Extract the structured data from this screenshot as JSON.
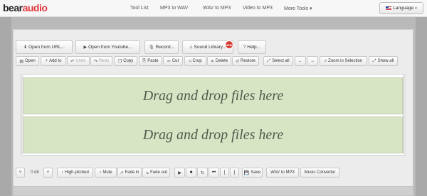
{
  "brand": {
    "part1": "bear",
    "part2": "audio"
  },
  "nav": [
    {
      "label": "Tool List"
    },
    {
      "label": "MP3 to WAV"
    },
    {
      "label": "WAV to MP3"
    },
    {
      "label": "Video to MP3"
    },
    {
      "label": "More Tools ▾"
    }
  ],
  "language": {
    "label": "Language",
    "caret": "▾"
  },
  "toolbar_top": [
    {
      "icon": "⬇",
      "label": "Open from URL..."
    },
    {
      "icon": "▶",
      "label": "Open from Youtube..."
    },
    {
      "icon": "🎙",
      "label": "Record..."
    },
    {
      "icon": "♫",
      "label": "Sound Library..."
    },
    {
      "icon": "?",
      "label": "Help..."
    }
  ],
  "sound_library_badge": "NEW",
  "toolbar_edit": [
    {
      "icon": "▤",
      "label": "Open"
    },
    {
      "icon": "+",
      "label": "Add to"
    },
    {
      "icon": "↶",
      "label": "Undo"
    },
    {
      "icon": "↷",
      "label": "Redo"
    },
    {
      "icon": "❐",
      "label": "Copy"
    },
    {
      "icon": "⎘",
      "label": "Paste"
    },
    {
      "icon": "✂",
      "label": "Cut"
    },
    {
      "icon": "⌑",
      "label": "Crop"
    },
    {
      "icon": "✕",
      "label": "Delete"
    },
    {
      "icon": "↺",
      "label": "Restore"
    },
    {
      "icon": "⤢",
      "label": "Select all"
    },
    {
      "icon": "",
      "label": "←"
    },
    {
      "icon": "",
      "label": "→"
    },
    {
      "icon": "⌕",
      "label": "Zoom in Selection"
    },
    {
      "icon": "⤢",
      "label": "Show all"
    }
  ],
  "tracks": [
    {
      "label": "Drag and drop files here"
    },
    {
      "label": "Drag and drop files here"
    }
  ],
  "bottom": {
    "vol_down": "˅",
    "db_value": "0 db",
    "vol_up": "˄",
    "buttons": [
      {
        "icon": "↑",
        "label": "High-pitched"
      },
      {
        "icon": "♪",
        "label": "Mute"
      },
      {
        "icon": "↗",
        "label": "Fade in"
      },
      {
        "icon": "↘",
        "label": "Fade out"
      },
      {
        "icon": "",
        "label": "▶"
      },
      {
        "icon": "",
        "label": "■"
      },
      {
        "icon": "",
        "label": "↻"
      },
      {
        "icon": "",
        "label": "⏮"
      },
      {
        "icon": "",
        "label": "["
      },
      {
        "icon": "",
        "label": "]"
      },
      {
        "icon": "💾",
        "label": "Save"
      },
      {
        "icon": "",
        "label": "WAV to MP3"
      },
      {
        "icon": "",
        "label": "Music Converter"
      }
    ]
  },
  "colors": {
    "accent": "#e03a3e",
    "track_fill": "#d8e5c5"
  }
}
